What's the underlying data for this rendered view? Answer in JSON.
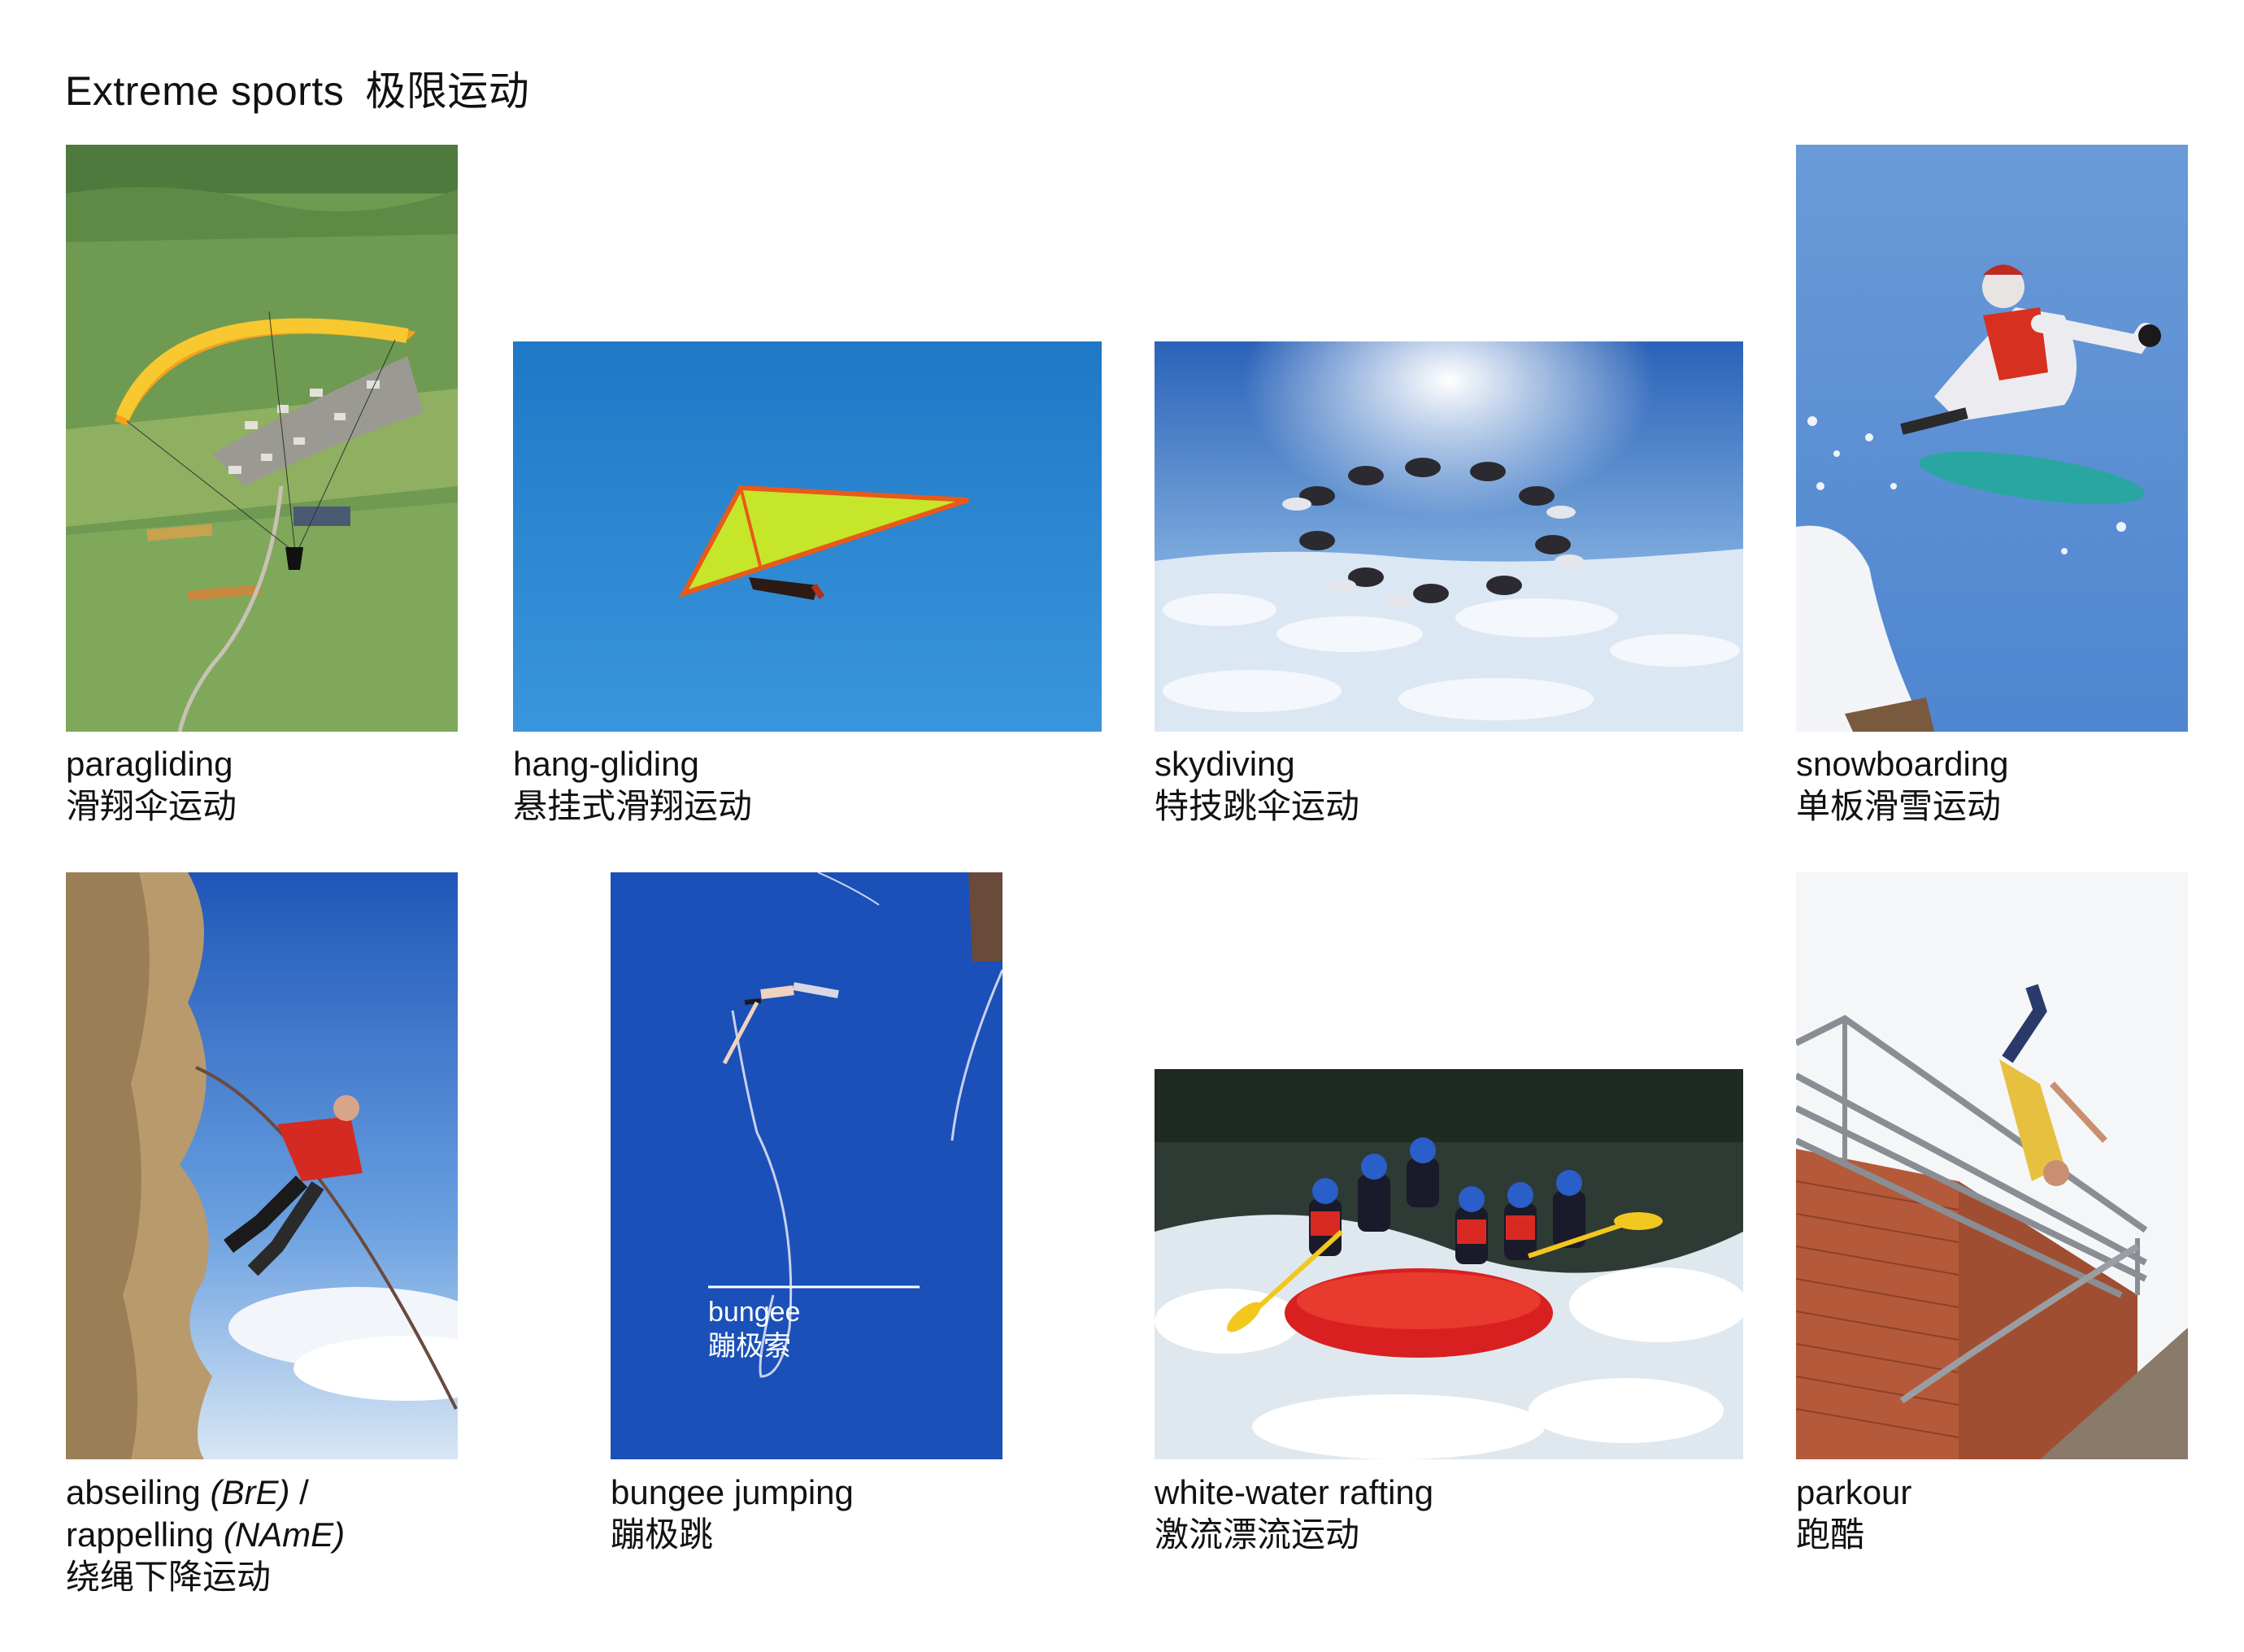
{
  "page": {
    "title_en": "Extreme sports",
    "title_zh": "极限运动"
  },
  "items": [
    {
      "en": "paragliding",
      "zh": "滑翔伞运动"
    },
    {
      "en": "hang-gliding",
      "zh": "悬挂式滑翔运动"
    },
    {
      "en": "skydiving",
      "zh": "特技跳伞运动"
    },
    {
      "en": "snowboarding",
      "zh": "单板滑雪运动"
    },
    {
      "en_1": "abseiling",
      "en_1_note": "(BrE)",
      "sep": " /",
      "en_2": "rappelling",
      "en_2_note": "(NAmE)",
      "zh": "绕绳下降运动"
    },
    {
      "en": "bungee jumping",
      "zh": "蹦极跳",
      "callout_en": "bungee",
      "callout_zh": "蹦极索"
    },
    {
      "en": "white-water rafting",
      "zh": "激流漂流运动"
    },
    {
      "en": "parkour",
      "zh": "跑酷"
    }
  ]
}
